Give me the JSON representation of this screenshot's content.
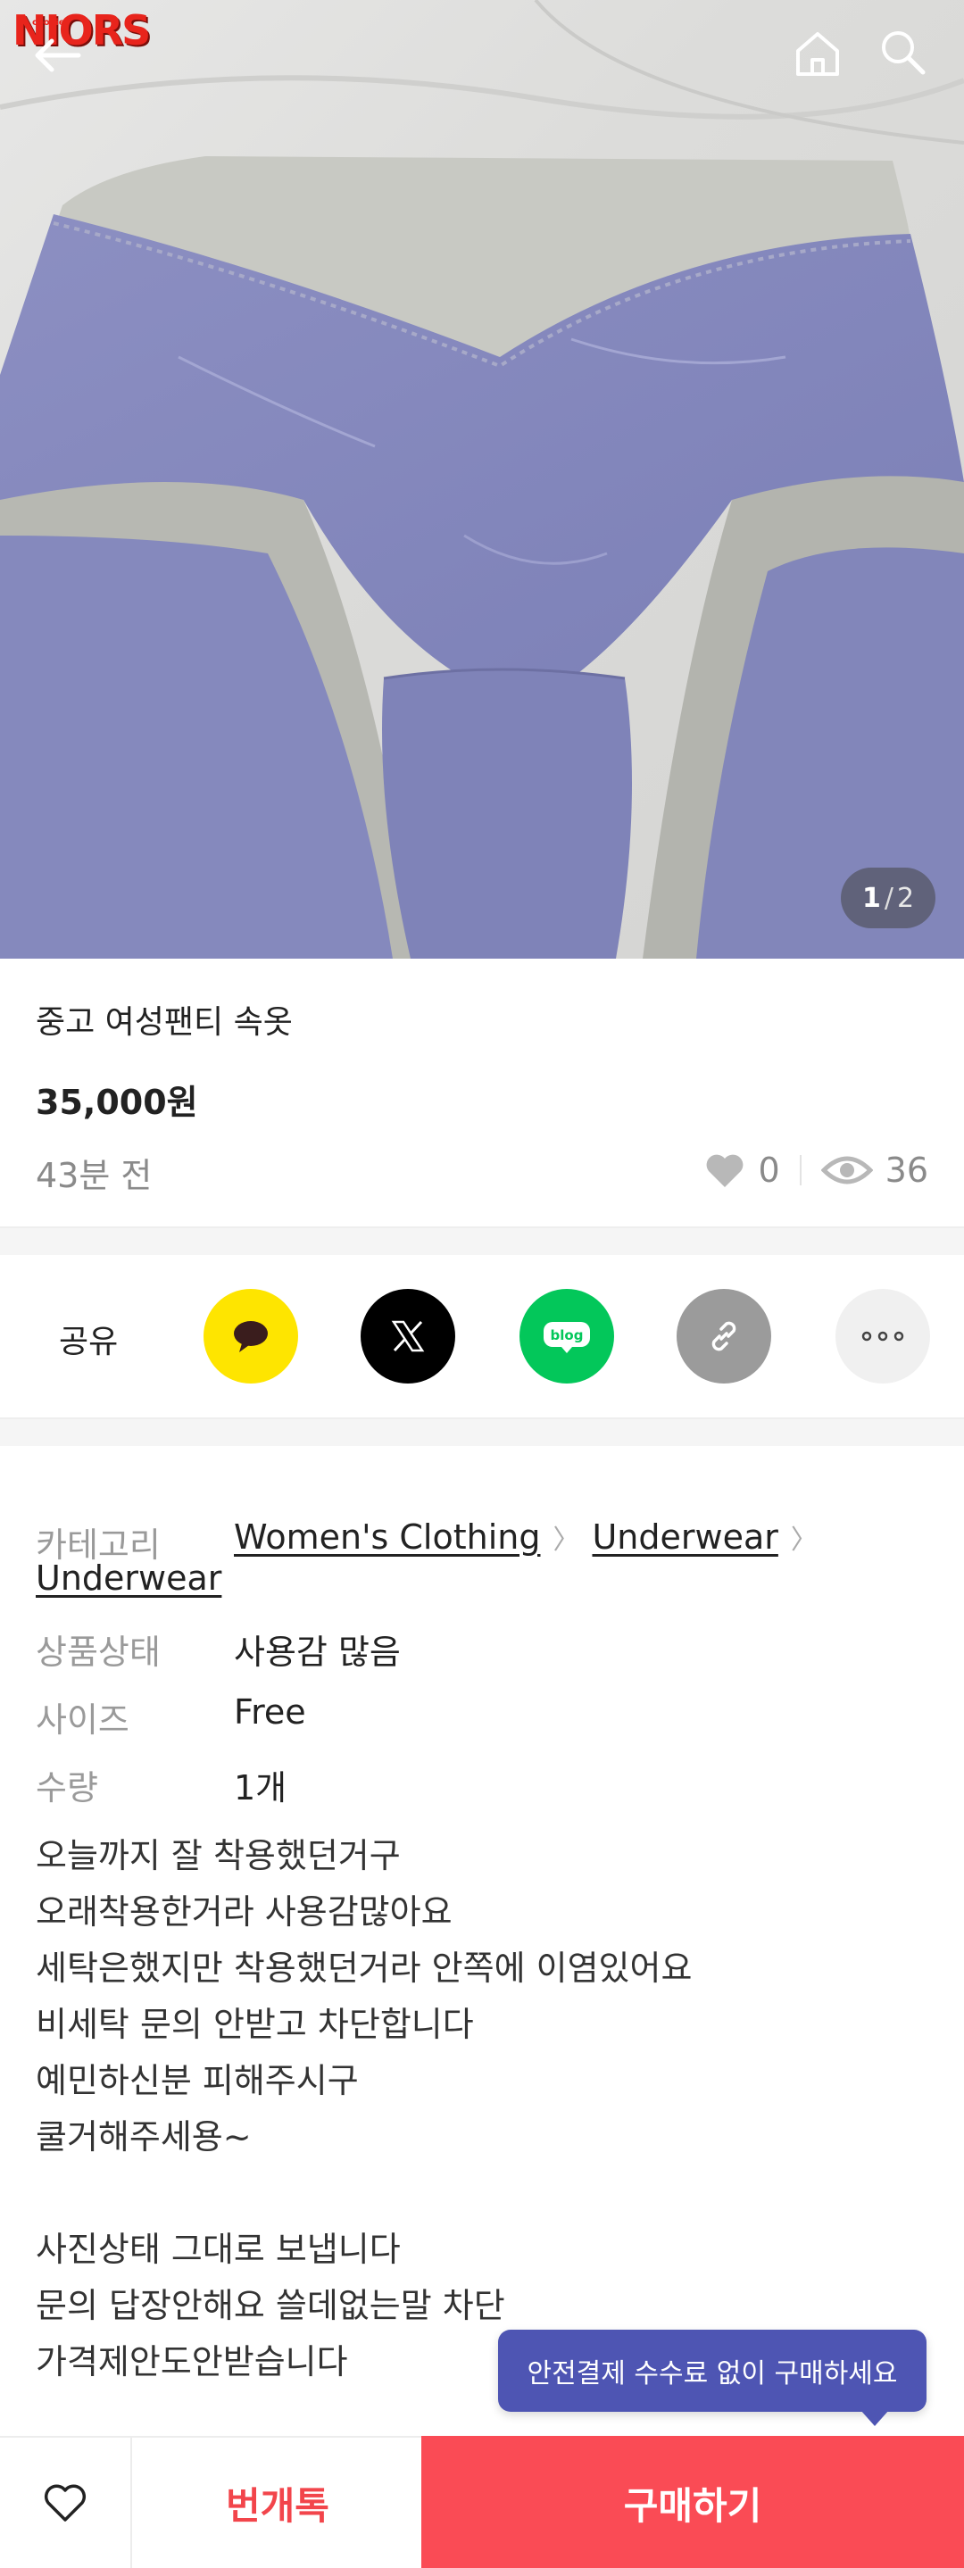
{
  "app": {
    "logo_text": "NIORS",
    "logo_small": "cookie"
  },
  "header": {
    "back_icon": "arrow-left-icon",
    "home_icon": "home-icon",
    "search_icon": "search-icon"
  },
  "gallery": {
    "current": "1",
    "separator": "/",
    "total": "2"
  },
  "product": {
    "title": "중고 여성팬티 속옷",
    "price": "35,000원",
    "posted": "43분 전",
    "likes": "0",
    "views": "36"
  },
  "share": {
    "label": "공유",
    "buttons": [
      {
        "name": "kakao",
        "icon": "kakao-chat-icon",
        "color": "#fee500"
      },
      {
        "name": "x",
        "icon": "x-logo-icon",
        "color": "#000000"
      },
      {
        "name": "blog",
        "icon": "blog-icon",
        "text": "blog",
        "color": "#03c75a"
      },
      {
        "name": "link",
        "icon": "link-icon",
        "color": "#9b9b9b"
      },
      {
        "name": "more",
        "icon": "more-icon",
        "color": "#f0f0f0"
      }
    ]
  },
  "details": {
    "category_label": "카테고리",
    "category_path": [
      "Women's Clothing",
      "Underwear",
      "Underwear"
    ],
    "condition_label": "상품상태",
    "condition_value": "사용감 많음",
    "size_label": "사이즈",
    "size_value": "Free",
    "quantity_label": "수량",
    "quantity_value": "1개"
  },
  "description": [
    "오늘까지 잘 착용했던거구",
    "오래착용한거라 사용감많아요",
    "세탁은했지만 착용했던거라 안쪽에 이염있어요",
    "비세탁 문의 안받고 차단합니다",
    "예민하신분 피해주시구",
    "쿨거해주세용~",
    "",
    "사진상태 그대로 보냅니다",
    "문의 답장안해요 쓸데없는말 차단",
    "가격제안도안받습니다"
  ],
  "tooltip": {
    "text": "안전결제 수수료 없이 구매하세요",
    "color": "#4e55b3"
  },
  "actions": {
    "favorite_icon": "heart-outline-icon",
    "chat_label": "번개톡",
    "buy_label": "구매하기",
    "buy_color": "#fa4b55",
    "chat_color": "#f2454b"
  }
}
